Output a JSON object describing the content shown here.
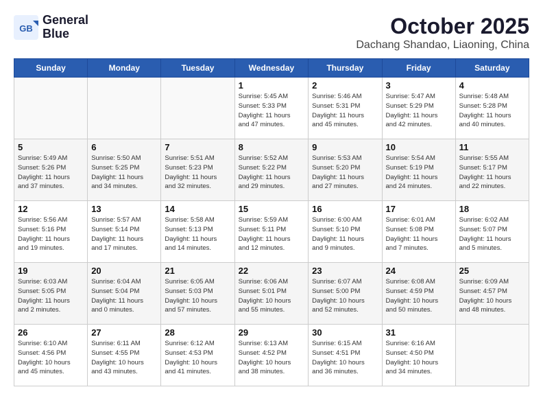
{
  "header": {
    "logo_line1": "General",
    "logo_line2": "Blue",
    "month": "October 2025",
    "location": "Dachang Shandao, Liaoning, China"
  },
  "weekdays": [
    "Sunday",
    "Monday",
    "Tuesday",
    "Wednesday",
    "Thursday",
    "Friday",
    "Saturday"
  ],
  "weeks": [
    [
      {
        "day": "",
        "info": ""
      },
      {
        "day": "",
        "info": ""
      },
      {
        "day": "",
        "info": ""
      },
      {
        "day": "1",
        "info": "Sunrise: 5:45 AM\nSunset: 5:33 PM\nDaylight: 11 hours\nand 47 minutes."
      },
      {
        "day": "2",
        "info": "Sunrise: 5:46 AM\nSunset: 5:31 PM\nDaylight: 11 hours\nand 45 minutes."
      },
      {
        "day": "3",
        "info": "Sunrise: 5:47 AM\nSunset: 5:29 PM\nDaylight: 11 hours\nand 42 minutes."
      },
      {
        "day": "4",
        "info": "Sunrise: 5:48 AM\nSunset: 5:28 PM\nDaylight: 11 hours\nand 40 minutes."
      }
    ],
    [
      {
        "day": "5",
        "info": "Sunrise: 5:49 AM\nSunset: 5:26 PM\nDaylight: 11 hours\nand 37 minutes."
      },
      {
        "day": "6",
        "info": "Sunrise: 5:50 AM\nSunset: 5:25 PM\nDaylight: 11 hours\nand 34 minutes."
      },
      {
        "day": "7",
        "info": "Sunrise: 5:51 AM\nSunset: 5:23 PM\nDaylight: 11 hours\nand 32 minutes."
      },
      {
        "day": "8",
        "info": "Sunrise: 5:52 AM\nSunset: 5:22 PM\nDaylight: 11 hours\nand 29 minutes."
      },
      {
        "day": "9",
        "info": "Sunrise: 5:53 AM\nSunset: 5:20 PM\nDaylight: 11 hours\nand 27 minutes."
      },
      {
        "day": "10",
        "info": "Sunrise: 5:54 AM\nSunset: 5:19 PM\nDaylight: 11 hours\nand 24 minutes."
      },
      {
        "day": "11",
        "info": "Sunrise: 5:55 AM\nSunset: 5:17 PM\nDaylight: 11 hours\nand 22 minutes."
      }
    ],
    [
      {
        "day": "12",
        "info": "Sunrise: 5:56 AM\nSunset: 5:16 PM\nDaylight: 11 hours\nand 19 minutes."
      },
      {
        "day": "13",
        "info": "Sunrise: 5:57 AM\nSunset: 5:14 PM\nDaylight: 11 hours\nand 17 minutes."
      },
      {
        "day": "14",
        "info": "Sunrise: 5:58 AM\nSunset: 5:13 PM\nDaylight: 11 hours\nand 14 minutes."
      },
      {
        "day": "15",
        "info": "Sunrise: 5:59 AM\nSunset: 5:11 PM\nDaylight: 11 hours\nand 12 minutes."
      },
      {
        "day": "16",
        "info": "Sunrise: 6:00 AM\nSunset: 5:10 PM\nDaylight: 11 hours\nand 9 minutes."
      },
      {
        "day": "17",
        "info": "Sunrise: 6:01 AM\nSunset: 5:08 PM\nDaylight: 11 hours\nand 7 minutes."
      },
      {
        "day": "18",
        "info": "Sunrise: 6:02 AM\nSunset: 5:07 PM\nDaylight: 11 hours\nand 5 minutes."
      }
    ],
    [
      {
        "day": "19",
        "info": "Sunrise: 6:03 AM\nSunset: 5:05 PM\nDaylight: 11 hours\nand 2 minutes."
      },
      {
        "day": "20",
        "info": "Sunrise: 6:04 AM\nSunset: 5:04 PM\nDaylight: 11 hours\nand 0 minutes."
      },
      {
        "day": "21",
        "info": "Sunrise: 6:05 AM\nSunset: 5:03 PM\nDaylight: 10 hours\nand 57 minutes."
      },
      {
        "day": "22",
        "info": "Sunrise: 6:06 AM\nSunset: 5:01 PM\nDaylight: 10 hours\nand 55 minutes."
      },
      {
        "day": "23",
        "info": "Sunrise: 6:07 AM\nSunset: 5:00 PM\nDaylight: 10 hours\nand 52 minutes."
      },
      {
        "day": "24",
        "info": "Sunrise: 6:08 AM\nSunset: 4:59 PM\nDaylight: 10 hours\nand 50 minutes."
      },
      {
        "day": "25",
        "info": "Sunrise: 6:09 AM\nSunset: 4:57 PM\nDaylight: 10 hours\nand 48 minutes."
      }
    ],
    [
      {
        "day": "26",
        "info": "Sunrise: 6:10 AM\nSunset: 4:56 PM\nDaylight: 10 hours\nand 45 minutes."
      },
      {
        "day": "27",
        "info": "Sunrise: 6:11 AM\nSunset: 4:55 PM\nDaylight: 10 hours\nand 43 minutes."
      },
      {
        "day": "28",
        "info": "Sunrise: 6:12 AM\nSunset: 4:53 PM\nDaylight: 10 hours\nand 41 minutes."
      },
      {
        "day": "29",
        "info": "Sunrise: 6:13 AM\nSunset: 4:52 PM\nDaylight: 10 hours\nand 38 minutes."
      },
      {
        "day": "30",
        "info": "Sunrise: 6:15 AM\nSunset: 4:51 PM\nDaylight: 10 hours\nand 36 minutes."
      },
      {
        "day": "31",
        "info": "Sunrise: 6:16 AM\nSunset: 4:50 PM\nDaylight: 10 hours\nand 34 minutes."
      },
      {
        "day": "",
        "info": ""
      }
    ]
  ]
}
